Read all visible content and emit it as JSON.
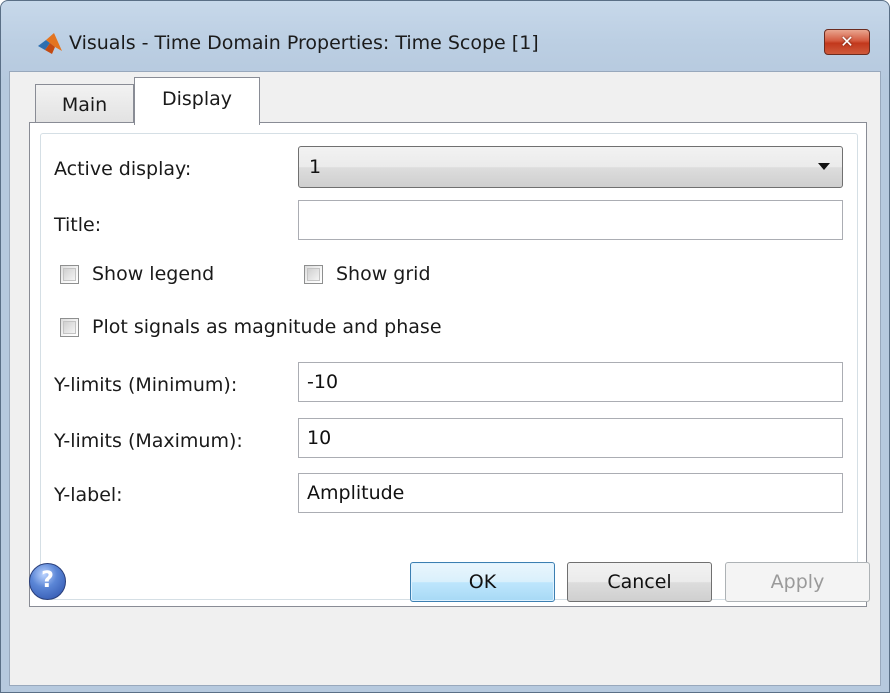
{
  "window": {
    "title": "Visuals - Time Domain Properties: Time Scope [1]",
    "close_label": "✕"
  },
  "tabs": [
    {
      "label": "Main",
      "selected": false
    },
    {
      "label": "Display",
      "selected": true
    }
  ],
  "display": {
    "active_display_label": "Active display:",
    "active_display_value": "1",
    "title_label": "Title:",
    "title_value": "",
    "show_legend_label": "Show legend",
    "show_legend_checked": false,
    "show_grid_label": "Show grid",
    "show_grid_checked": false,
    "plot_mag_phase_label": "Plot signals as magnitude and phase",
    "plot_mag_phase_checked": false,
    "ymin_label": "Y-limits (Minimum):",
    "ymin_value": "-10",
    "ymax_label": "Y-limits (Maximum):",
    "ymax_value": "10",
    "ylabel_label": "Y-label:",
    "ylabel_value": "Amplitude"
  },
  "buttons": {
    "help_glyph": "?",
    "ok": "OK",
    "cancel": "Cancel",
    "apply": "Apply"
  },
  "icons": {
    "app": "matlab-logo-icon",
    "help": "help-icon",
    "dropdown": "chevron-down-icon"
  }
}
